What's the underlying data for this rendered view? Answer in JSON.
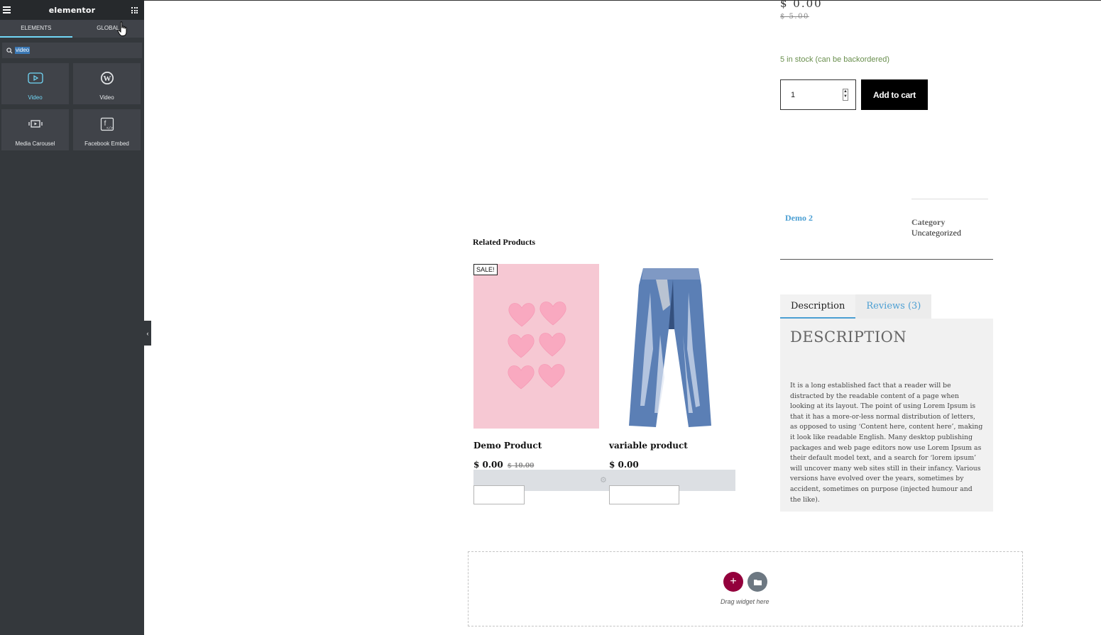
{
  "panel": {
    "logo": "elementor",
    "tabs": [
      {
        "label": "ELEMENTS",
        "active": true
      },
      {
        "label": "GLOBAL",
        "active": false
      }
    ],
    "search": {
      "value": "video"
    },
    "widgets": [
      {
        "label": "Video",
        "icon": "youtube-play-icon",
        "active": true
      },
      {
        "label": "Video",
        "icon": "wordpress-icon",
        "active": false
      },
      {
        "label": "Media Carousel",
        "icon": "media-carousel-icon",
        "active": false
      },
      {
        "label": "Facebook Embed",
        "icon": "facebook-embed-icon",
        "active": false
      }
    ]
  },
  "product": {
    "price": "$ 0.00",
    "old_price": "$ 5.00",
    "stock": "5 in stock (can be backordered)",
    "quantity": "1",
    "add_to_cart": "Add to cart",
    "meta": {
      "tag": "Demo 2",
      "category_label": "Category",
      "category_value": "Uncategorized"
    },
    "tabs": {
      "description": "Description",
      "reviews": "Reviews (3)"
    },
    "description_title": "DESCRIPTION",
    "description_text": "It is a long established fact that a reader will be distracted by the readable content of a page when looking at its layout. The point of using Lorem Ipsum is that it has a more-or-less normal distribution of letters, as opposed to using ‘Content here, content here’, making it look like readable English. Many desktop publishing packages and web page editors now use Lorem Ipsum as their default model text, and a search for ‘lorem ipsum’ will uncover many web sites still in their infancy. Various versions have evolved over the years, sometimes by accident, sometimes on purpose (injected humour and the like)."
  },
  "related": {
    "title": "Related Products",
    "items": [
      {
        "badge": "SALE!",
        "name": "Demo Product",
        "price": "$ 0.00",
        "old_price": "$ 10.00"
      },
      {
        "name": "variable product",
        "price": "$ 0.00"
      }
    ]
  },
  "dropzone": {
    "add_symbol": "+",
    "text": "Drag widget here"
  },
  "colors": {
    "panel_bg": "#34383c",
    "accent": "#71d7f7",
    "add_button": "#93003c",
    "link": "#4b9fd3"
  }
}
